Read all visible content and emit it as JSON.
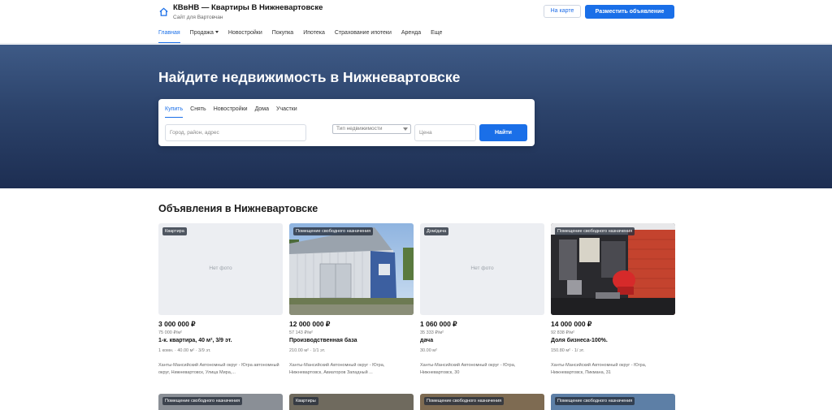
{
  "header": {
    "title": "КВвНВ — Квартиры В Нижневартовске",
    "subtitle": "Сайт для Вартовчан",
    "map_button": "На карте",
    "post_button": "Разместить объявление"
  },
  "nav": [
    {
      "label": "Главная"
    },
    {
      "label": "Продажа"
    },
    {
      "label": "Новостройки"
    },
    {
      "label": "Покупка"
    },
    {
      "label": "Ипотека"
    },
    {
      "label": "Страхование ипотеки"
    },
    {
      "label": "Аренда"
    },
    {
      "label": "Еще"
    }
  ],
  "hero": {
    "title": "Найдите недвижимость в Нижневартовске",
    "tabs": [
      {
        "label": "Купить"
      },
      {
        "label": "Снять"
      },
      {
        "label": "Новостройки"
      },
      {
        "label": "Дома"
      },
      {
        "label": "Участки"
      }
    ],
    "city_placeholder": "Город, район, адрес",
    "type_placeholder": "Тип недвижимости",
    "price_placeholder": "Цена",
    "find_button": "Найти"
  },
  "listings": {
    "title": "Объявления в Нижневартовске",
    "no_photo": "Нет фото",
    "cards": [
      {
        "badge": "Квартира",
        "price": "3 000 000 ₽",
        "ppm": "75 000 ₽/м²",
        "title": "1-к. квартира, 40 м², 3/9 эт.",
        "meta": "1 комн. · 40.00 м² · 3/9 эт.",
        "address": "Ханты-Мансийский Автономный округ - Югра автономный округ, Нижневартовск, Улица Мира,..."
      },
      {
        "badge": "Помещение свободного назначения",
        "price": "12 000 000 ₽",
        "ppm": "57 143 ₽/м²",
        "title": "Производственная база",
        "meta": "210.00 м² · 1/1 эт.",
        "address": "Ханты-Мансийский Автономный округ - Югра, Нижневартовск, Авиаторов Западный ..."
      },
      {
        "badge": "Дом/дача",
        "price": "1 060 000 ₽",
        "ppm": "35 333 ₽/м²",
        "title": "дача",
        "meta": "30.00 м²",
        "address": "Ханты-Мансийский Автономный округ - Югра, Нижневартовск, 30"
      },
      {
        "badge": "Помещение свободного назначения",
        "price": "14 000 000 ₽",
        "ppm": "92 838 ₽/м²",
        "title": "Доля бизнеса-100%.",
        "meta": "150.80 м² · 1/ эт.",
        "address": "Ханты-Мансийский Автономный округ - Югра, Нижневартовск, Пикмана, 31"
      }
    ],
    "next_row_badges": [
      "Помещение свободного назначения",
      "Квартиры",
      "Помещение свободного назначения",
      "Помещение свободного назначения"
    ]
  }
}
